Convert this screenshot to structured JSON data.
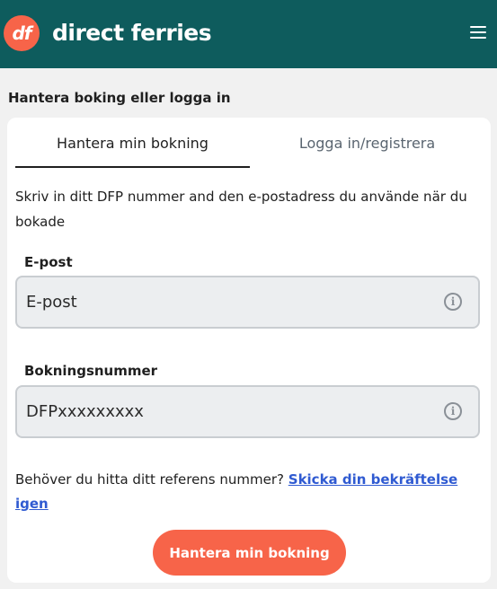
{
  "header": {
    "logo_text": "df",
    "brand": "direct ferries",
    "menu_icon": "hamburger-menu-icon"
  },
  "page": {
    "section_title": "Hantera boking eller logga in"
  },
  "tabs": [
    {
      "label": "Hantera min bokning",
      "active": true
    },
    {
      "label": "Logga in/registrera",
      "active": false
    }
  ],
  "form": {
    "intro": "Skriv in ditt DFP nummer and den e-postadress du använde när du bokade",
    "email": {
      "label": "E-post",
      "placeholder": "E-post",
      "value": "",
      "icon": "info-icon"
    },
    "booking": {
      "label": "Bokningsnummer",
      "placeholder": "DFPxxxxxxxxx",
      "value": "",
      "icon": "info-icon"
    },
    "help_text": "Behöver du hitta ditt referens nummer?",
    "help_link": "Skicka din bekräftelse igen",
    "submit_label": "Hantera min bokning"
  },
  "colors": {
    "header_bg": "#0e5c5d",
    "accent": "#f76449",
    "link": "#2f5ad1",
    "page_bg": "#f1f1f1"
  }
}
